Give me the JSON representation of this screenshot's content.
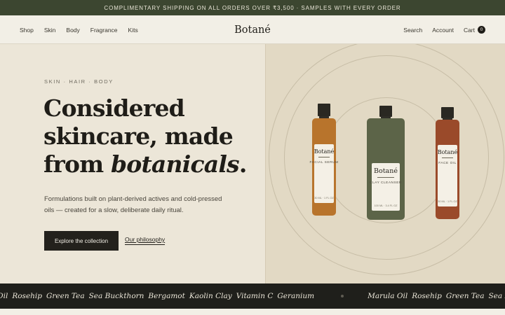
{
  "announcement": "COMPLIMENTARY SHIPPING ON ALL ORDERS OVER ₹3,500 · SAMPLES WITH EVERY ORDER",
  "header": {
    "nav_left": [
      "Shop",
      "Skin",
      "Body",
      "Fragrance",
      "Kits"
    ],
    "logo": "Botané",
    "search": "Search",
    "account": "Account",
    "cart": "Cart",
    "cart_count": "0"
  },
  "hero": {
    "eyebrow": "SKIN · HAIR · BODY",
    "headline_line1": "Considered",
    "headline_line2": "skincare, made",
    "headline_line3_prefix": "from ",
    "headline_line3_em": "botanicals",
    "headline_line3_suffix": ".",
    "subcopy": "Formulations built on plant-derived actives and cold-pressed oils — created for a slow, deliberate daily ritual.",
    "cta_primary": "Explore the collection",
    "cta_secondary": "Our philosophy"
  },
  "products": [
    {
      "brand": "Botané",
      "name": "FACIAL SERUM",
      "size": "30 ML · 1 FL OZ",
      "color": "#b8742c"
    },
    {
      "brand": "Botané",
      "name": "CLAY CLEANSER",
      "size": "100 ML · 3.4 FL OZ",
      "color": "#5c6448"
    },
    {
      "brand": "Botané",
      "name": "FACE OIL",
      "size": "30 ML · 1 FL OZ",
      "color": "#9a4a2a"
    }
  ],
  "ticker": {
    "group1": [
      "Oil",
      "Rosehip",
      "Green Tea",
      "Sea Buckthorn",
      "Bergamot",
      "Kaolin Clay",
      "Vitamin C",
      "Geranium"
    ],
    "group2": [
      "Marula Oil",
      "Rosehip",
      "Green Tea",
      "Sea Buckthorn"
    ]
  },
  "colors": {
    "announcement_bg": "#3c4630",
    "header_bg": "#f2efe6",
    "hero_left_bg": "#ece6d8",
    "hero_right_bg": "#e2d9c4",
    "cta_bg": "#23211c",
    "ticker_bg": "#1f1f1b"
  }
}
